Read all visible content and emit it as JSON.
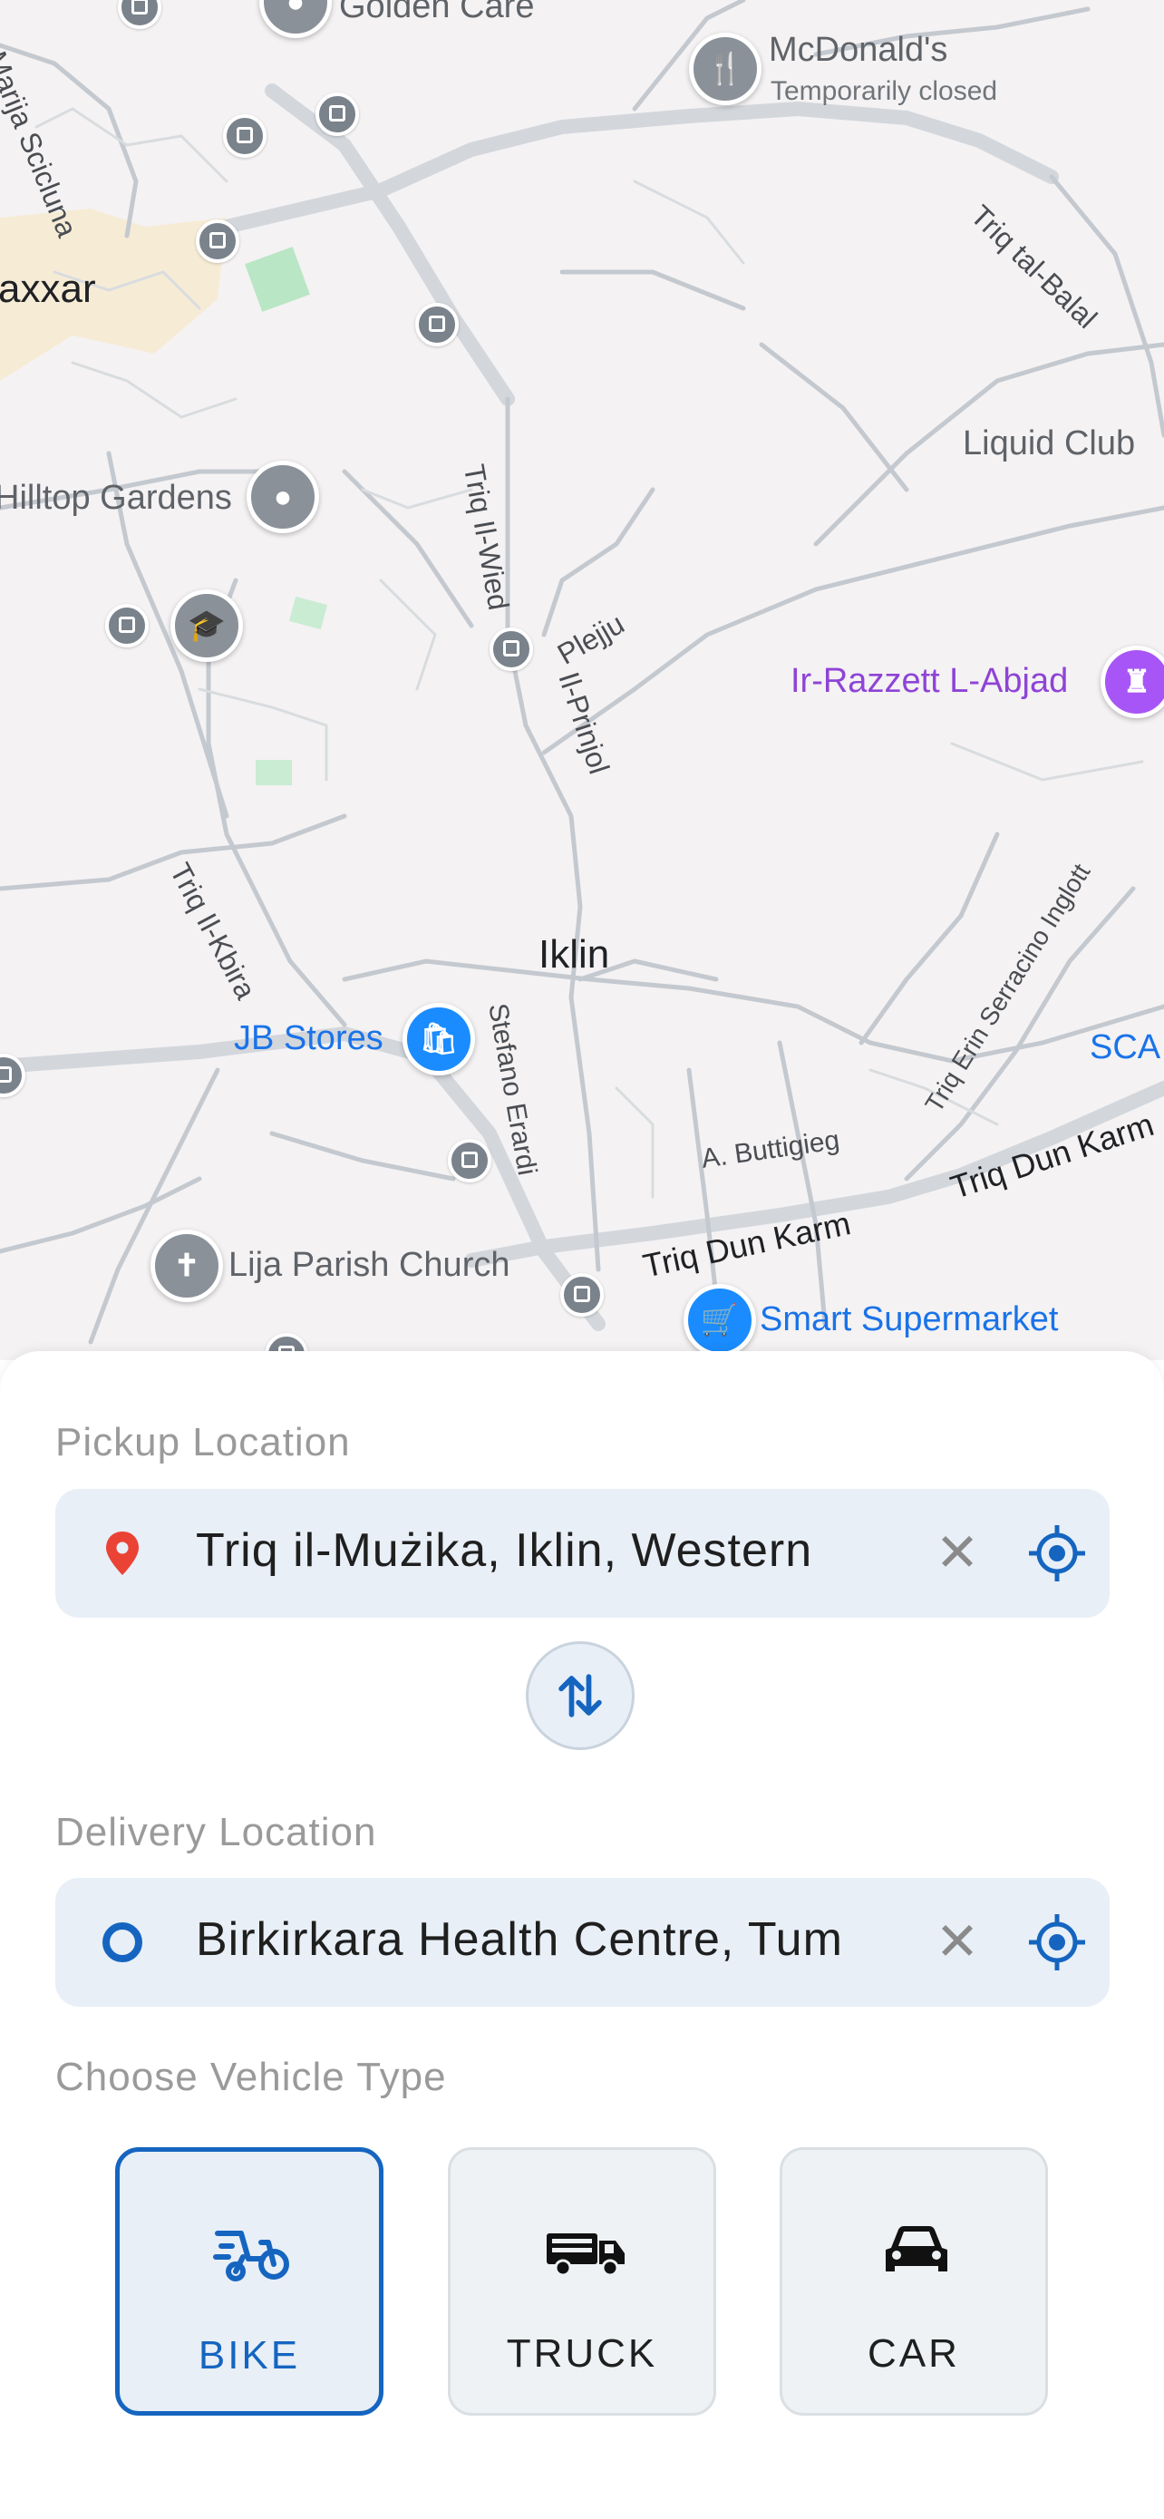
{
  "map": {
    "places": {
      "golden_care": "Golden Care",
      "mcdonalds": "McDonald's",
      "mcdonalds_status": "Temporarily closed",
      "naxxar": "axxar",
      "liquid_club": "Liquid Club",
      "hilltop_gardens": "Hilltop Gardens",
      "razzett": "Ir-Razzett L-Abjad",
      "iklin": "Iklin",
      "jb_stores": "JB Stores",
      "sca": "SCA",
      "lija_church": "Lija Parish Church",
      "smart_supermarket": "Smart Supermarket"
    },
    "streets": {
      "marija_scicluna": "Marija Scicluna",
      "tal_balal": "Triq tal-Balal",
      "il_wied": "Triq Il-Wied",
      "pleiju": "Plejju",
      "il_prinjol": "Il-Prinjol",
      "il_kbira": "Triq Il-Kbira",
      "serracino": "Triq Erin Serracino Inglott",
      "stefano_erardi": "Stefano Erardi",
      "buttigieg": "A. Buttigieg",
      "dun_karm_1": "Triq Dun Karm",
      "dun_karm_2": "Triq Dun Karm"
    }
  },
  "pickup": {
    "label": "Pickup Location",
    "value": "Triq il-Mużika, Iklin, Western",
    "lead_icon": "red-location-pin-icon",
    "accent": "#ea4335"
  },
  "delivery": {
    "label": "Delivery Location",
    "value": "Birkirkara Health Centre, Tum",
    "lead_icon": "blue-ring-icon",
    "accent": "#1565c0"
  },
  "vehicle": {
    "label": "Choose Vehicle Type",
    "options": [
      {
        "label": "BIKE",
        "icon": "bike-icon",
        "selected": true
      },
      {
        "label": "TRUCK",
        "icon": "truck-icon",
        "selected": false
      },
      {
        "label": "CAR",
        "icon": "car-icon",
        "selected": false
      }
    ]
  },
  "colors": {
    "primary": "#1565c0",
    "field_bg": "#e8eff7",
    "map_bg": "#f4f2f3"
  }
}
